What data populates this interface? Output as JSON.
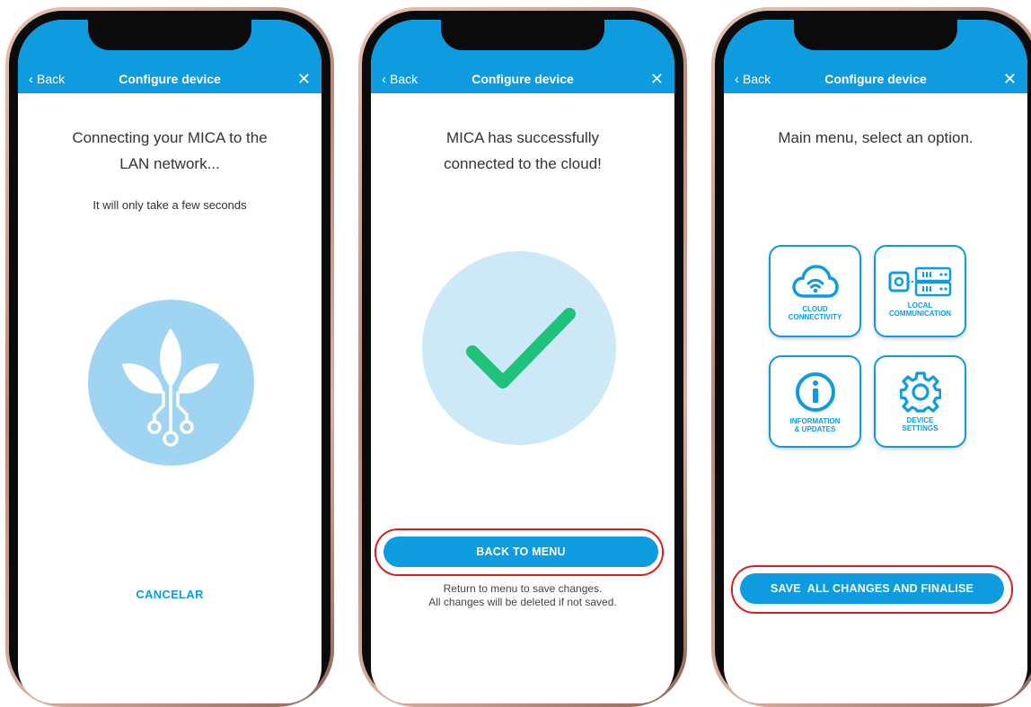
{
  "colors": {
    "primary": "#0e9be0",
    "highlight": "#d62020",
    "check": "#1fc27a",
    "plant_circle": "#9fd4f2",
    "success_circle": "#cde9f8"
  },
  "screens": [
    {
      "appbar": {
        "back_label": "Back",
        "title": "Configure device",
        "close_icon": "close-icon"
      },
      "heading_line1": "Connecting your MICA to the",
      "heading_line2": "LAN network...",
      "subtitle": "It will only take a few seconds",
      "illustration": "plant-circuit-icon",
      "cancel_label": "CANCELAR"
    },
    {
      "appbar": {
        "back_label": "Back",
        "title": "Configure device",
        "close_icon": "close-icon"
      },
      "heading_line1": "MICA has successfully",
      "heading_line2": "connected to the cloud!",
      "illustration": "checkmark-icon",
      "button_label": "BACK TO MENU",
      "note_line1": "Return to menu to save changes.",
      "note_line2": "All changes will be deleted if not saved."
    },
    {
      "appbar": {
        "back_label": "Back",
        "title": "Configure device",
        "close_icon": "close-icon"
      },
      "heading": "Main menu, select an option.",
      "tiles": [
        {
          "label": "CLOUD\nCONNECTIVITY",
          "icon": "cloud-wifi-icon"
        },
        {
          "label": "LOCAL\nCOMMUNICATION",
          "icon": "server-connection-icon"
        },
        {
          "label": "INFORMATION\n& UPDATES",
          "icon": "info-icon"
        },
        {
          "label": "DEVICE\nSETTINGS",
          "icon": "gear-icon"
        }
      ],
      "button_label": "SAVE  ALL CHANGES AND FINALISE"
    }
  ]
}
